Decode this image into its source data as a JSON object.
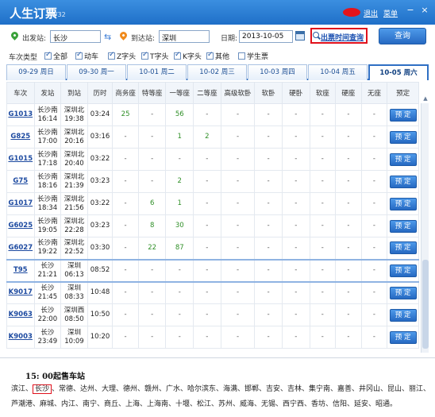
{
  "titlebar": {
    "title": "人生订票",
    "version": "V32",
    "logout": "退出",
    "menu": "菜单",
    "minimize": "−",
    "close": "×"
  },
  "search": {
    "from_label": "出发站:",
    "from_value": "长沙",
    "to_label": "到达站:",
    "to_value": "深圳",
    "date_label": "日期:",
    "date_value": "2013-10-05",
    "schedule_link": "出票时间查询",
    "query_button": "查询"
  },
  "filters": {
    "label": "车次类型",
    "items": [
      {
        "label": "全部",
        "checked": true
      },
      {
        "label": "动车",
        "checked": true
      },
      {
        "label": "Z字头",
        "checked": true
      },
      {
        "label": "T字头",
        "checked": true
      },
      {
        "label": "K字头",
        "checked": true
      },
      {
        "label": "其他",
        "checked": true
      },
      {
        "label": "学生票",
        "checked": false
      }
    ]
  },
  "date_tabs": [
    {
      "label": "09-29 周日"
    },
    {
      "label": "09-30 周一"
    },
    {
      "label": "10-01 周二"
    },
    {
      "label": "10-02 周三"
    },
    {
      "label": "10-03 周四"
    },
    {
      "label": "10-04 周五"
    },
    {
      "label": "10-05 周六",
      "active": true
    }
  ],
  "table": {
    "columns": [
      "车次",
      "发站",
      "到站",
      "历时",
      "商务座",
      "特等座",
      "一等座",
      "二等座",
      "高级软卧",
      "软卧",
      "硬卧",
      "软座",
      "硬座",
      "无座",
      "预定"
    ],
    "book_label": "预 定",
    "rows": [
      {
        "train": "G1013",
        "from": "长沙南",
        "dep": "16:14",
        "to": "深圳北",
        "arr": "19:38",
        "dur": "03:24",
        "seats": [
          "25",
          "-",
          "56",
          "-",
          "-",
          "-",
          "-",
          "-",
          "-",
          "-"
        ]
      },
      {
        "train": "G825",
        "from": "长沙南",
        "dep": "17:00",
        "to": "深圳北",
        "arr": "20:16",
        "dur": "03:16",
        "seats": [
          "-",
          "-",
          "1",
          "2",
          "-",
          "-",
          "-",
          "-",
          "-",
          "-"
        ]
      },
      {
        "train": "G1015",
        "from": "长沙南",
        "dep": "17:18",
        "to": "深圳北",
        "arr": "20:40",
        "dur": "03:22",
        "seats": [
          "-",
          "-",
          "-",
          "-",
          "-",
          "-",
          "-",
          "-",
          "-",
          "-"
        ]
      },
      {
        "train": "G75",
        "from": "长沙南",
        "dep": "18:16",
        "to": "深圳北",
        "arr": "21:39",
        "dur": "03:23",
        "seats": [
          "-",
          "-",
          "2",
          "-",
          "-",
          "-",
          "-",
          "-",
          "-",
          "-"
        ]
      },
      {
        "train": "G1017",
        "from": "长沙南",
        "dep": "18:34",
        "to": "深圳北",
        "arr": "21:56",
        "dur": "03:22",
        "seats": [
          "-",
          "6",
          "1",
          "-",
          "-",
          "-",
          "-",
          "-",
          "-",
          "-"
        ]
      },
      {
        "train": "G6025",
        "from": "长沙南",
        "dep": "19:05",
        "to": "深圳北",
        "arr": "22:28",
        "dur": "03:23",
        "seats": [
          "-",
          "8",
          "30",
          "-",
          "-",
          "-",
          "-",
          "-",
          "-",
          "-"
        ]
      },
      {
        "train": "G6027",
        "from": "长沙南",
        "dep": "19:22",
        "to": "深圳北",
        "arr": "22:52",
        "dur": "03:30",
        "seats": [
          "-",
          "22",
          "87",
          "-",
          "-",
          "-",
          "-",
          "-",
          "-",
          "-"
        ]
      },
      {
        "train": "T95",
        "from": "长沙",
        "dep": "21:21",
        "to": "深圳",
        "arr": "06:13",
        "dur": "08:52",
        "seats": [
          "-",
          "-",
          "-",
          "-",
          "-",
          "-",
          "-",
          "-",
          "-",
          "-"
        ],
        "selected": true
      },
      {
        "train": "K9017",
        "from": "长沙",
        "dep": "21:45",
        "to": "深圳",
        "arr": "08:33",
        "dur": "10:48",
        "seats": [
          "-",
          "-",
          "-",
          "-",
          "-",
          "-",
          "-",
          "-",
          "-",
          "-"
        ]
      },
      {
        "train": "K9063",
        "from": "长沙",
        "dep": "22:00",
        "to": "深圳西",
        "arr": "08:50",
        "dur": "10:50",
        "seats": [
          "-",
          "-",
          "-",
          "-",
          "-",
          "-",
          "-",
          "-",
          "-",
          "-"
        ]
      },
      {
        "train": "K9003",
        "from": "长沙",
        "dep": "23:49",
        "to": "深圳",
        "arr": "10:09",
        "dur": "10:20",
        "seats": [
          "-",
          "-",
          "-",
          "-",
          "-",
          "-",
          "-",
          "-",
          "-",
          "-"
        ]
      }
    ]
  },
  "sale_info": {
    "title": "15: 00起售车站",
    "before": "滨江、",
    "highlight": "长沙",
    "after": "、常德、达州、大理、德州、赣州、广水、哈尔滨东、海满、邯郸、吉安、吉林、集宁南、嘉善、井冈山、昆山、丽江、芦潮港、麻城、内江、南宁、商丘、上海、上海南、十堰、松江、苏州、威海、无锡、西宁西、香坊、信阳、延安、昭通。"
  },
  "colors": {
    "accent": "#2f6fc4",
    "highlight_red": "#e0101b",
    "seat_green": "#2f8f27"
  }
}
